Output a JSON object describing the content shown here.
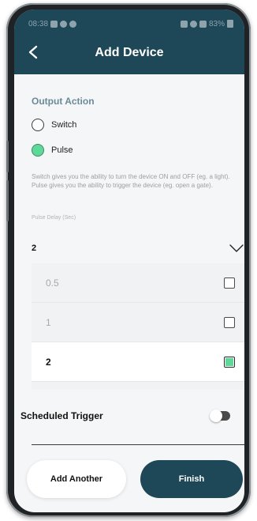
{
  "status_bar": {
    "time": "08:38",
    "battery": "83%"
  },
  "header": {
    "title": "Add Device",
    "back_icon": "chevron-left-icon"
  },
  "output_action": {
    "title": "Output Action",
    "options": [
      {
        "label": "Switch",
        "selected": false
      },
      {
        "label": "Pulse",
        "selected": true
      }
    ],
    "help_text": "Switch gives you the ability to turn the device ON and OFF (eg. a light). Pulse gives you the ability to trigger the device (eg. open a gate)."
  },
  "pulse_delay": {
    "label": "Pulse Delay (Sec)",
    "selected_value": "2",
    "options": [
      {
        "label": "0.5",
        "checked": false
      },
      {
        "label": "1",
        "checked": false
      },
      {
        "label": "2",
        "checked": true
      }
    ]
  },
  "scheduled_trigger": {
    "label": "Scheduled Trigger",
    "enabled": false
  },
  "footer": {
    "add_another_label": "Add Another",
    "finish_label": "Finish"
  },
  "colors": {
    "primary": "#1e4757",
    "accent": "#5fd99a",
    "section_title": "#6a8a98"
  }
}
